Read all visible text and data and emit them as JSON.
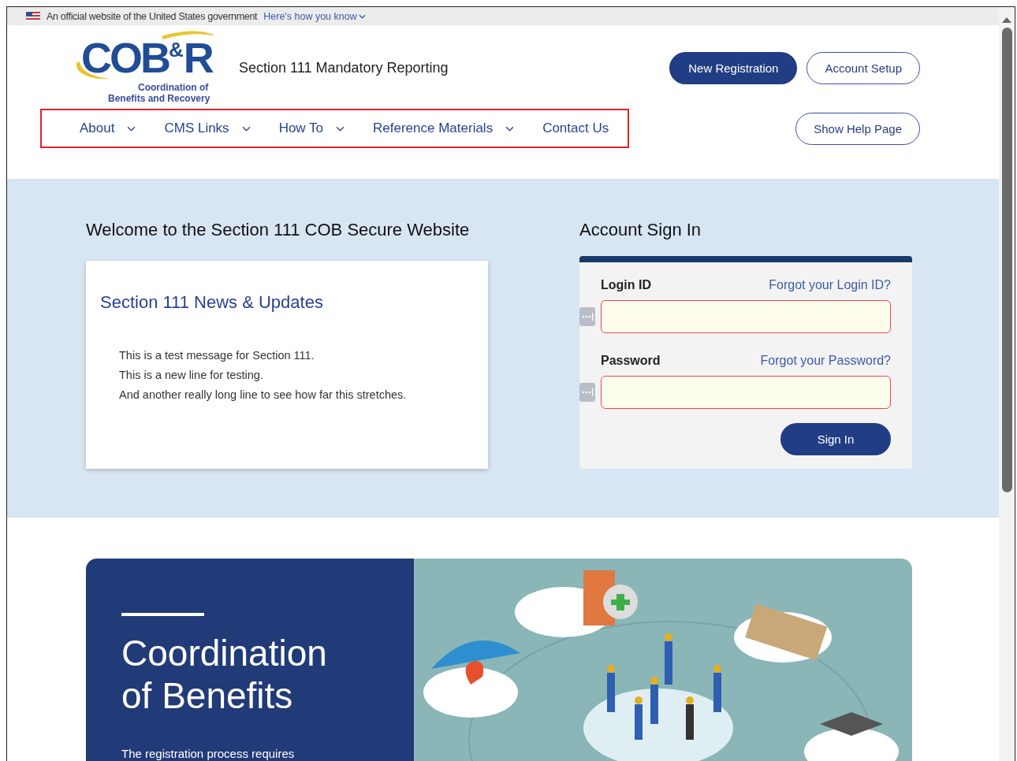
{
  "gov_banner": {
    "text": "An official website of the United States government",
    "link": "Here's how you know"
  },
  "header": {
    "logo": {
      "wordmark": "COB",
      "amp": "&",
      "letter": "R",
      "subtitle_1": "Coordination of",
      "subtitle_2": "Benefits and Recovery"
    },
    "title": "Section 111 Mandatory Reporting",
    "buttons": [
      {
        "label": "New Registration",
        "kind": "primary"
      },
      {
        "label": "Account Setup",
        "kind": "outline"
      }
    ],
    "help_button": "Show Help Page"
  },
  "nav": {
    "highlighted": true,
    "items": [
      {
        "label": "About",
        "kind": "dropdown"
      },
      {
        "label": "CMS Links",
        "kind": "dropdown"
      },
      {
        "label": "How To",
        "kind": "dropdown"
      },
      {
        "label": "Reference Materials",
        "kind": "dropdown"
      },
      {
        "label": "Contact Us",
        "kind": "link"
      }
    ]
  },
  "welcome": {
    "heading": "Welcome to the Section 111 COB Secure Website",
    "news": {
      "title": "Section 111 News & Updates",
      "lines": [
        "This is a test message for Section 111.",
        "This is a new line for testing.",
        "And another really long line to see how far this stretches."
      ]
    }
  },
  "sign_in": {
    "heading": "Account Sign In",
    "fields": [
      {
        "label": "Login ID",
        "link": "Forgot your Login ID?",
        "invalid": true
      },
      {
        "label": "Password",
        "link": "Forgot your Password?",
        "invalid": true
      }
    ],
    "button": "Sign In"
  },
  "hero": {
    "title_1": "Coordination",
    "title_2": "of Benefits",
    "text": "The registration process requires"
  }
}
